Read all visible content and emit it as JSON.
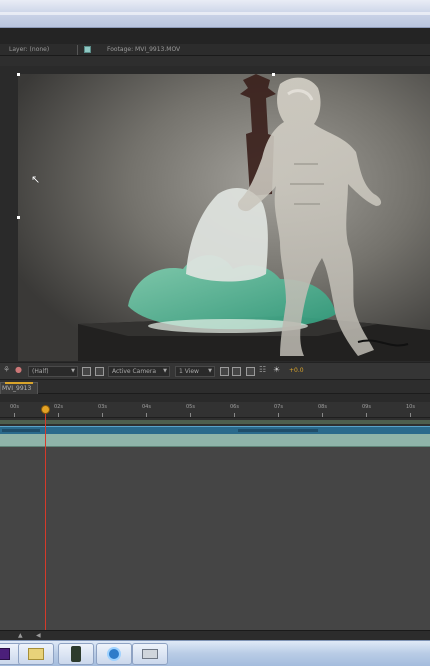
{
  "viewer": {
    "tabs": {
      "layer": "Layer: (none)",
      "footage": "Footage: MVI_9913.MOV"
    },
    "toolbar": {
      "resolution": "(Half)",
      "camera": "Active Camera",
      "views": "1 View",
      "exposure": "+0.0"
    },
    "footage_description_icons": {
      "cursor": "arrow-cursor-icon"
    }
  },
  "timeline": {
    "composition_tab": "MVI_9913",
    "ruler_ticks": [
      "00s",
      "02s",
      "03s",
      "04s",
      "05s",
      "06s",
      "07s",
      "08s",
      "09s",
      "10s"
    ],
    "playhead_time_label": "01s"
  },
  "taskbar": {
    "items": [
      "premiere-icon",
      "folder-icon",
      "media-encoder-icon",
      "quicktime-icon",
      "drive-icon"
    ]
  },
  "colors": {
    "accent_orange": "#d9a42b",
    "playhead_red": "#d43a2a",
    "layer_blue": "#2a6a8c",
    "track_green": "#8fb4a9"
  }
}
